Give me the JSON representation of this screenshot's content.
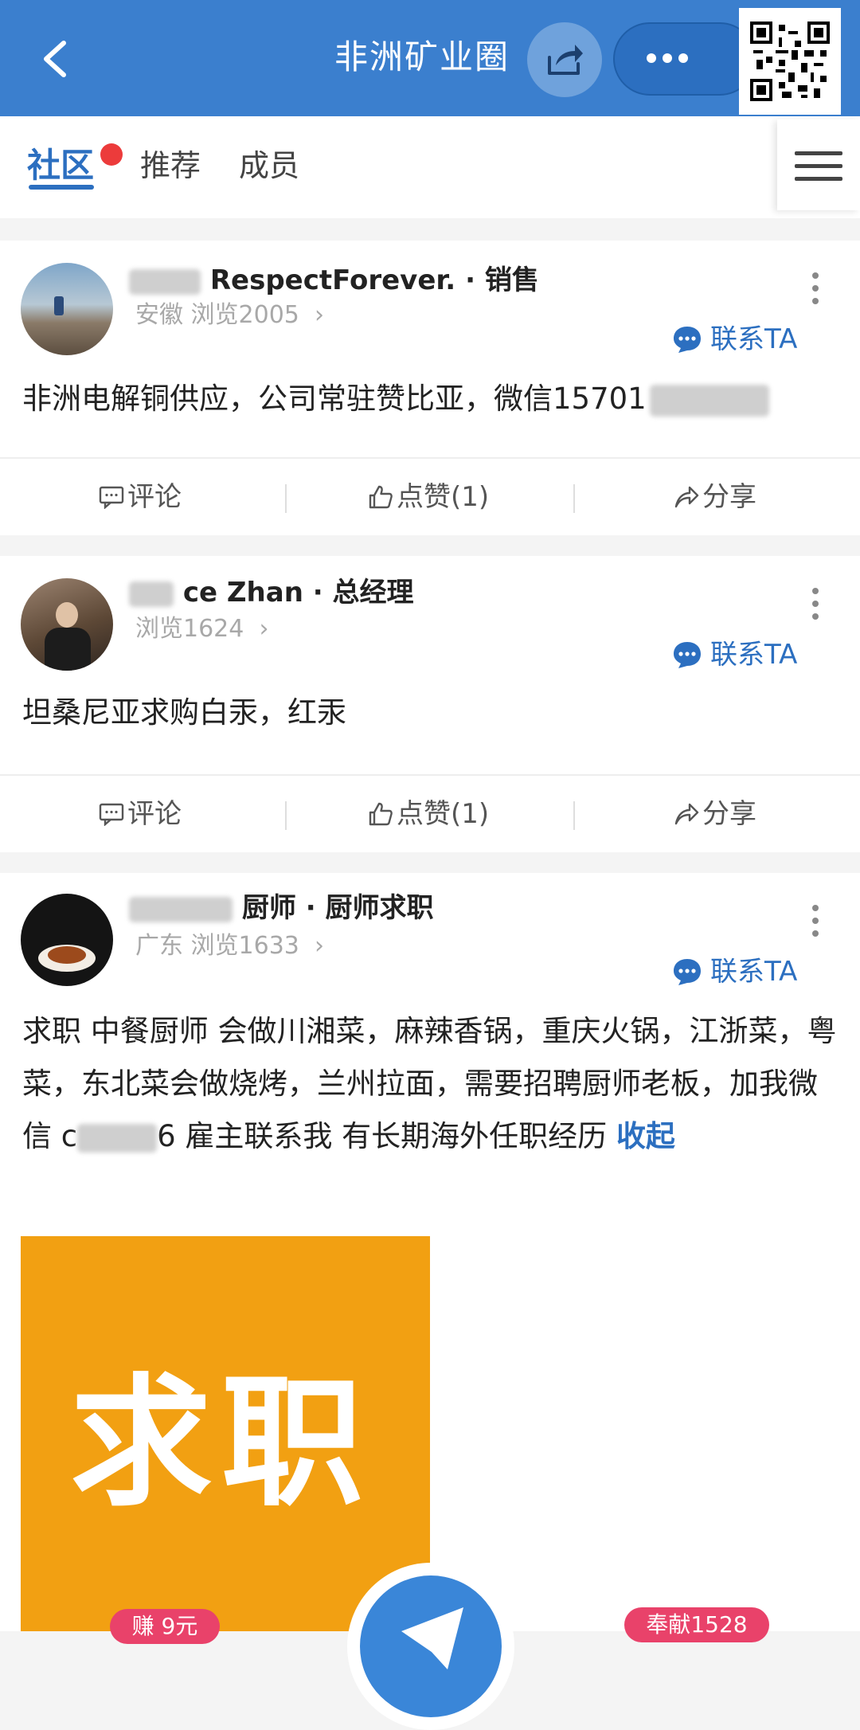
{
  "header": {
    "title": "非洲矿业圈",
    "icons": {
      "back": "back-arrow-icon",
      "share": "share-icon",
      "more": "more-dots-icon",
      "qr": "qr-code-icon"
    }
  },
  "tabs": {
    "items": [
      "社区",
      "推荐",
      "成员"
    ],
    "active": "社区"
  },
  "posts": [
    {
      "name_visible": "RespectForever.",
      "role": "· 销售",
      "location": "安徽",
      "views": "浏览2005",
      "contact": "联系TA",
      "text": "非洲电解铜供应，公司常驻赞比亚，微信15701",
      "comment": "评论",
      "like": "点赞(1)",
      "share": "分享"
    },
    {
      "name_visible": "ce Zhan",
      "role": "· 总经理",
      "views": "浏览1624",
      "contact": "联系TA",
      "text": "坦桑尼亚求购白汞，红汞",
      "comment": "评论",
      "like": "点赞(1)",
      "share": "分享"
    },
    {
      "name_visible": "厨师",
      "role": "· 厨师求职",
      "location": "广东",
      "views": "浏览1633",
      "contact": "联系TA",
      "text_before": "求职 中餐厨师 会做川湘菜，麻辣香锅，重庆火锅，江浙菜，粤菜，东北菜会做烧烤，兰州拉面，需要招聘厨师老板，加我微信 c",
      "text_after": "6 雇主联系我 有长期海外任职经历",
      "collapse": "收起",
      "image_text": "求职"
    }
  ],
  "badges": {
    "earn": "赚 9元",
    "contrib": "奉献1528"
  },
  "colors": {
    "brand": "#3b7fce",
    "accent": "#2c6fc0",
    "badge": "#e9426a",
    "image": "#f2a012"
  }
}
